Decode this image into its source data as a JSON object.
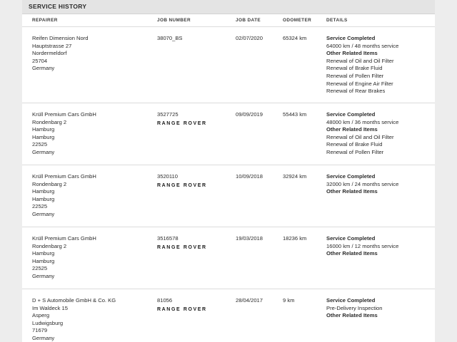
{
  "header": {
    "title": "SERVICE HISTORY"
  },
  "columns": {
    "repairer": "REPAIRER",
    "job_number": "JOB NUMBER",
    "job_date": "JOB DATE",
    "odometer": "ODOMETER",
    "details": "DETAILS"
  },
  "records": [
    {
      "repairer": [
        "Reifen Dimension Nord",
        "Hauptstrasse 27",
        "Nordermeldorf",
        "25704",
        "Germany"
      ],
      "job_number": "38070_BS",
      "brand": "",
      "job_date": "02/07/2020",
      "odometer": "65324 km",
      "details": [
        {
          "text": "Service Completed",
          "bold": true
        },
        {
          "text": "64000 km / 48 months service",
          "bold": false
        },
        {
          "text": "Other Related Items",
          "bold": true
        },
        {
          "text": "Renewal of Oil and Oil Filter",
          "bold": false
        },
        {
          "text": "Renewal of Brake Fluid",
          "bold": false
        },
        {
          "text": "Renewal of Pollen Filter",
          "bold": false
        },
        {
          "text": "Renewal of Engine Air Filter",
          "bold": false
        },
        {
          "text": "Renewal of Rear Brakes",
          "bold": false
        }
      ]
    },
    {
      "repairer": [
        "Krüll Premium Cars GmbH",
        "Rondenbarg 2",
        "Hamburg",
        "Hamburg",
        "22525",
        "Germany"
      ],
      "job_number": "3527725",
      "brand": "RANGE ROVER",
      "job_date": "09/09/2019",
      "odometer": "55443 km",
      "details": [
        {
          "text": "Service Completed",
          "bold": true
        },
        {
          "text": "48000 km / 36 months service",
          "bold": false
        },
        {
          "text": "Other Related Items",
          "bold": true
        },
        {
          "text": "Renewal of Oil and Oil Filter",
          "bold": false
        },
        {
          "text": "Renewal of Brake Fluid",
          "bold": false
        },
        {
          "text": "Renewal of Pollen Filter",
          "bold": false
        }
      ]
    },
    {
      "repairer": [
        "Krüll Premium Cars GmbH",
        "Rondenbarg 2",
        "Hamburg",
        "Hamburg",
        "22525",
        "Germany"
      ],
      "job_number": "3520110",
      "brand": "RANGE ROVER",
      "job_date": "10/09/2018",
      "odometer": "32924 km",
      "details": [
        {
          "text": "Service Completed",
          "bold": true
        },
        {
          "text": "32000 km / 24 months service",
          "bold": false
        },
        {
          "text": "Other Related Items",
          "bold": true
        }
      ]
    },
    {
      "repairer": [
        "Krüll Premium Cars GmbH",
        "Rondenbarg 2",
        "Hamburg",
        "Hamburg",
        "22525",
        "Germany"
      ],
      "job_number": "3516578",
      "brand": "RANGE ROVER",
      "job_date": "19/03/2018",
      "odometer": "18236 km",
      "details": [
        {
          "text": "Service Completed",
          "bold": true
        },
        {
          "text": "16000 km / 12 months service",
          "bold": false
        },
        {
          "text": "Other Related Items",
          "bold": true
        }
      ]
    },
    {
      "repairer": [
        "D + S Automobile GmbH & Co. KG",
        "Im Waldeck 15",
        "Asperg",
        "Ludwigsburg",
        "71679",
        "Germany"
      ],
      "job_number": "81056",
      "brand": "RANGE ROVER",
      "job_date": "28/04/2017",
      "odometer": "9 km",
      "details": [
        {
          "text": "Service Completed",
          "bold": true
        },
        {
          "text": "Pre-Delivery Inspection",
          "bold": false
        },
        {
          "text": "Other Related Items",
          "bold": true
        }
      ]
    }
  ]
}
